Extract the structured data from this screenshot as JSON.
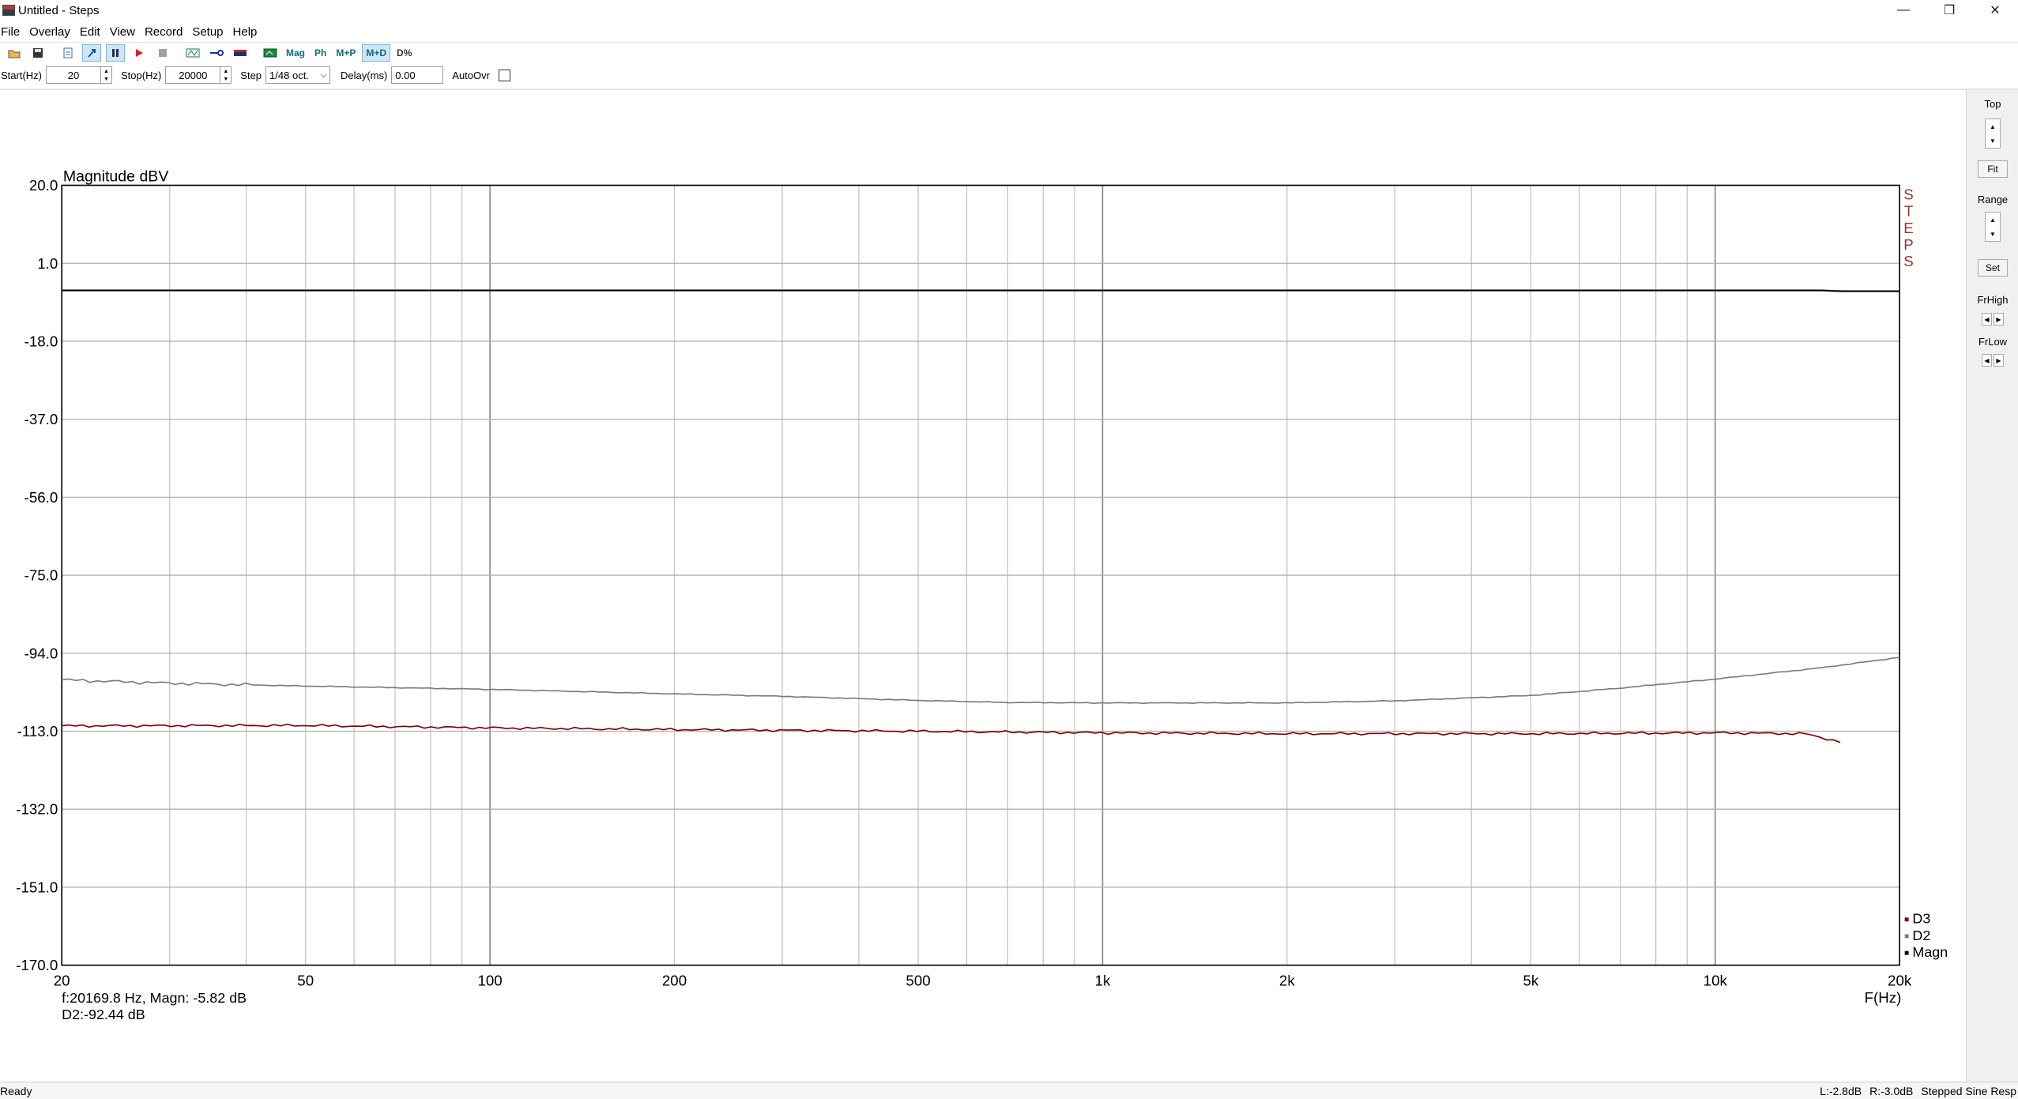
{
  "window": {
    "title": "Untitled - Steps",
    "min_glyph": "—",
    "max_glyph": "❐",
    "close_glyph": "✕"
  },
  "menu": [
    "File",
    "Overlay",
    "Edit",
    "View",
    "Record",
    "Setup",
    "Help"
  ],
  "toolbar": {
    "buttons": [
      "open-icon",
      "save-icon",
      "new-overlay-icon",
      "cursor-icon",
      "pause-icon",
      "play-icon",
      "stop-icon",
      "loop-icon",
      "generator-icon",
      "level-icon",
      "meter-icon"
    ],
    "mag_label": "Mag",
    "ph_label": "Ph",
    "mp_label": "M+P",
    "md_label": "M+D",
    "pct_label": "D%"
  },
  "params": {
    "start_label": "Start(Hz)",
    "start_value": "20",
    "stop_label": "Stop(Hz)",
    "stop_value": "20000",
    "step_label": "Step",
    "step_value": "1/48 oct.",
    "delay_label": "Delay(ms)",
    "delay_value": "0.00",
    "autoovr_label": "AutoOvr"
  },
  "right_panel": {
    "top_label": "Top",
    "fit_label": "Fit",
    "range_label": "Range",
    "set_label": "Set",
    "frhigh_label": "FrHigh",
    "frlow_label": "FrLow"
  },
  "chart_data": {
    "type": "line",
    "title": "Magnitude dBV",
    "xlabel": "F(Hz)",
    "xscale": "log",
    "xlim": [
      20,
      20000
    ],
    "ylim": [
      -170,
      20
    ],
    "yticks": [
      20.0,
      1.0,
      -18.0,
      -37.0,
      -56.0,
      -75.0,
      -94.0,
      -113.0,
      -132.0,
      -151.0,
      -170.0
    ],
    "ytick_labels": [
      "20.0",
      "1.0",
      "-18.0",
      "-37.0",
      "-56.0",
      "-75.0",
      "-94.0",
      "-113.0",
      "-132.0",
      "-151.0",
      "-170.0"
    ],
    "xtick_labels": [
      {
        "value": 20,
        "label": "20"
      },
      {
        "value": 50,
        "label": "50"
      },
      {
        "value": 100,
        "label": "100"
      },
      {
        "value": 200,
        "label": "200"
      },
      {
        "value": 500,
        "label": "500"
      },
      {
        "value": 1000,
        "label": "1k"
      },
      {
        "value": 2000,
        "label": "2k"
      },
      {
        "value": 5000,
        "label": "5k"
      },
      {
        "value": 10000,
        "label": "10k"
      },
      {
        "value": 20000,
        "label": "20k"
      }
    ],
    "side_label": "STEPS",
    "grid": true,
    "legend_position": "bottom-right",
    "series": [
      {
        "name": "Magn",
        "color": "#000000",
        "x": [
          20,
          50,
          100,
          200,
          500,
          1000,
          2000,
          5000,
          10000,
          15000,
          16000,
          20000
        ],
        "y": [
          -5.6,
          -5.6,
          -5.6,
          -5.6,
          -5.6,
          -5.6,
          -5.6,
          -5.6,
          -5.6,
          -5.6,
          -5.8,
          -5.8
        ]
      },
      {
        "name": "D2",
        "color": "#7a7a7a",
        "x": [
          20,
          30,
          50,
          100,
          200,
          300,
          500,
          700,
          1000,
          1500,
          2000,
          3000,
          5000,
          7000,
          10000,
          15000,
          20000
        ],
        "y": [
          -100.5,
          -101.3,
          -102.0,
          -102.8,
          -103.9,
          -104.5,
          -105.5,
          -106.0,
          -106.1,
          -106.1,
          -106.1,
          -105.6,
          -104.3,
          -102.5,
          -100.3,
          -97.5,
          -95.0
        ]
      },
      {
        "name": "D3",
        "color": "#7a0000",
        "x": [
          20,
          50,
          100,
          200,
          500,
          1000,
          2000,
          5000,
          10000,
          14000,
          16000
        ],
        "y": [
          -111.7,
          -111.6,
          -112.2,
          -112.6,
          -113.0,
          -113.4,
          -113.6,
          -113.6,
          -113.4,
          -113.6,
          -115.6
        ]
      }
    ],
    "readout": {
      "line1": "f:20169.8 Hz, Magn: -5.82 dB",
      "line2": "D2:-92.44 dB"
    }
  },
  "status": {
    "ready": "Ready",
    "left_level": "L:-2.8dB",
    "right_level": "R:-3.0dB",
    "mode": "Stepped Sine Resp"
  }
}
